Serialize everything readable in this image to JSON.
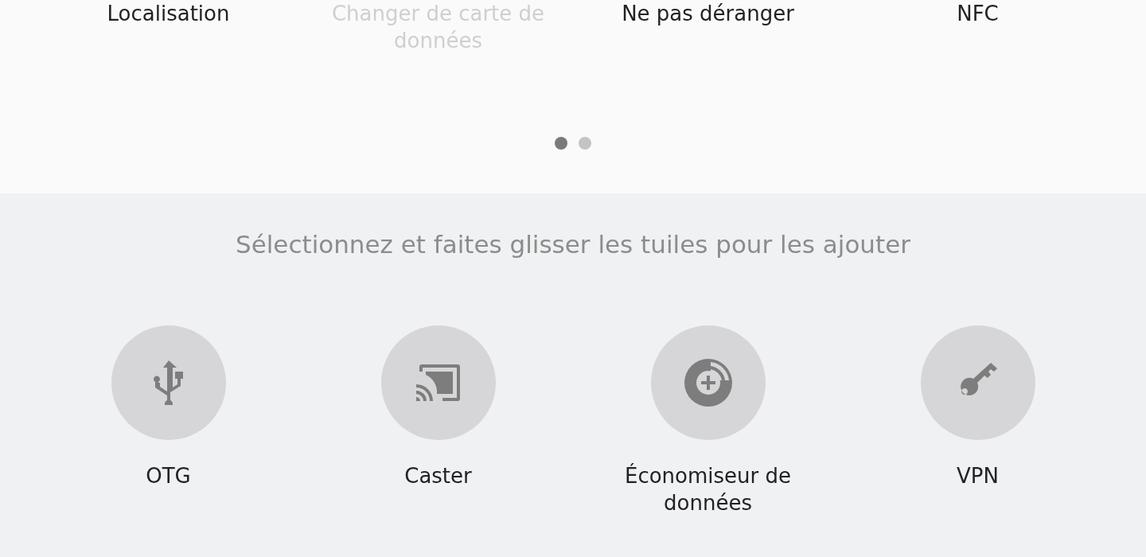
{
  "active_tiles": [
    {
      "label": "Localisation",
      "disabled": false
    },
    {
      "label": "Changer de carte de données",
      "disabled": true
    },
    {
      "label": "Ne pas déranger",
      "disabled": false
    },
    {
      "label": "NFC",
      "disabled": false
    }
  ],
  "pages": [
    {
      "selected": true
    },
    {
      "selected": false
    }
  ],
  "hint": "Sélectionnez et faites glisser les tuiles pour les ajouter",
  "available_tiles": [
    {
      "kind": "usb",
      "label": "OTG"
    },
    {
      "kind": "cast",
      "label": "Caster"
    },
    {
      "kind": "datasaver",
      "label": "Économiseur de données"
    },
    {
      "kind": "vpn",
      "label": "VPN"
    }
  ]
}
